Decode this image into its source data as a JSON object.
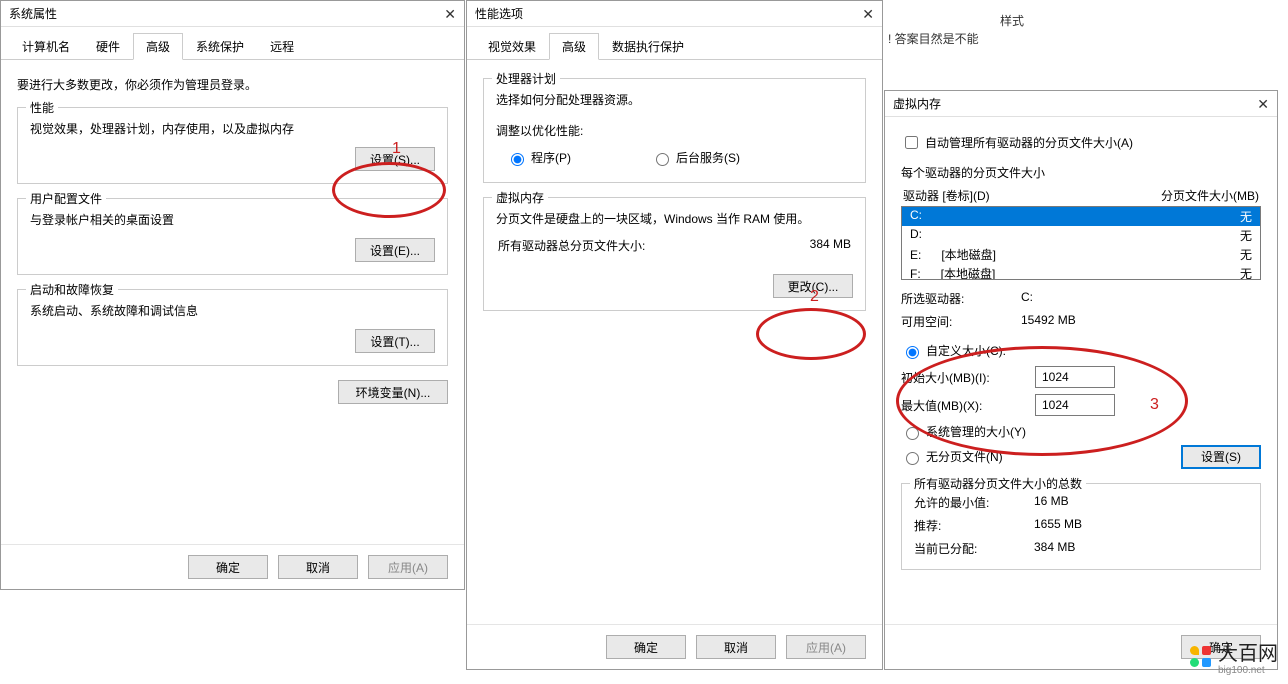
{
  "bg": {
    "styles_label": "样式",
    "fragment": "! 答案目然是不能"
  },
  "sysprops": {
    "title": "系统属性",
    "tabs": [
      "计算机名",
      "硬件",
      "高级",
      "系统保护",
      "远程"
    ],
    "active_tab": 2,
    "intro": "要进行大多数更改，你必须作为管理员登录。",
    "perf": {
      "title": "性能",
      "desc": "视觉效果，处理器计划，内存使用，以及虚拟内存",
      "btn": "设置(S)..."
    },
    "profiles": {
      "title": "用户配置文件",
      "desc": "与登录帐户相关的桌面设置",
      "btn": "设置(E)..."
    },
    "startup": {
      "title": "启动和故障恢复",
      "desc": "系统启动、系统故障和调试信息",
      "btn": "设置(T)..."
    },
    "env_btn": "环境变量(N)...",
    "ok": "确定",
    "cancel": "取消",
    "apply": "应用(A)"
  },
  "perfopts": {
    "title": "性能选项",
    "tabs": [
      "视觉效果",
      "高级",
      "数据执行保护"
    ],
    "active_tab": 1,
    "sched": {
      "title": "处理器计划",
      "desc": "选择如何分配处理器资源。",
      "adjust_label": "调整以优化性能:",
      "opt_programs": "程序(P)",
      "opt_bg": "后台服务(S)"
    },
    "vm": {
      "title": "虚拟内存",
      "desc": "分页文件是硬盘上的一块区域，Windows 当作 RAM 使用。",
      "total_label": "所有驱动器总分页文件大小:",
      "total_value": "384 MB",
      "change_btn": "更改(C)..."
    },
    "ok": "确定",
    "cancel": "取消",
    "apply": "应用(A)"
  },
  "vmdlg": {
    "title": "虚拟内存",
    "auto_chk": "自动管理所有驱动器的分页文件大小(A)",
    "each_drive_label": "每个驱动器的分页文件大小",
    "hdr_drive": "驱动器 [卷标](D)",
    "hdr_size": "分页文件大小(MB)",
    "drives": [
      {
        "letter": "C:",
        "label": "",
        "size": "无",
        "selected": true
      },
      {
        "letter": "D:",
        "label": "",
        "size": "无",
        "selected": false
      },
      {
        "letter": "E:",
        "label": "[本地磁盘]",
        "size": "无",
        "selected": false
      },
      {
        "letter": "F:",
        "label": "[本地磁盘]",
        "size": "无",
        "selected": false
      }
    ],
    "sel_drive_label": "所选驱动器:",
    "sel_drive_value": "C:",
    "free_label": "可用空间:",
    "free_value": "15492 MB",
    "custom_radio": "自定义大小(C):",
    "init_label": "初始大小(MB)(I):",
    "init_value": "1024",
    "max_label": "最大值(MB)(X):",
    "max_value": "1024",
    "sys_radio": "系统管理的大小(Y)",
    "none_radio": "无分页文件(N)",
    "set_btn": "设置(S)",
    "totals_title": "所有驱动器分页文件大小的总数",
    "min_label": "允许的最小值:",
    "min_value": "16 MB",
    "rec_label": "推荐:",
    "rec_value": "1655 MB",
    "cur_label": "当前已分配:",
    "cur_value": "384 MB",
    "ok": "确定"
  },
  "annotations": {
    "n1": "1",
    "n2": "2",
    "n3": "3"
  },
  "logo": {
    "name": "大百网",
    "sub": "big100.net"
  }
}
